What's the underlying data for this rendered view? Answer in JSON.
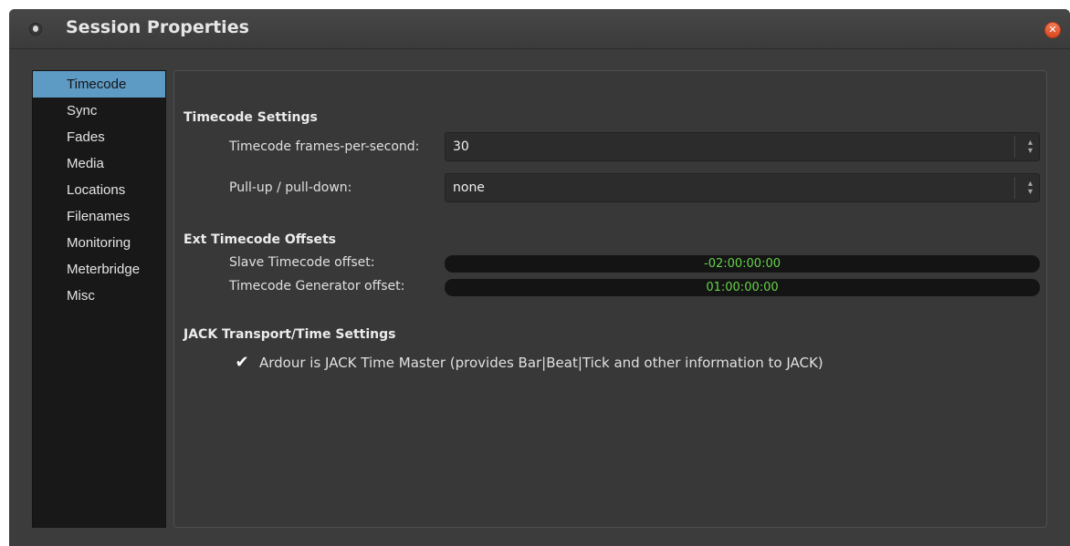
{
  "window": {
    "title": "Session Properties"
  },
  "sidebar": {
    "items": [
      {
        "label": "Timecode",
        "active": true
      },
      {
        "label": "Sync"
      },
      {
        "label": "Fades"
      },
      {
        "label": "Media"
      },
      {
        "label": "Locations"
      },
      {
        "label": "Filenames"
      },
      {
        "label": "Monitoring"
      },
      {
        "label": "Meterbridge"
      },
      {
        "label": "Misc"
      }
    ]
  },
  "timecode_settings": {
    "heading": "Timecode Settings",
    "fps_label": "Timecode frames-per-second:",
    "fps_value": "30",
    "pull_label": "Pull-up / pull-down:",
    "pull_value": "none"
  },
  "ext_offsets": {
    "heading": "Ext Timecode Offsets",
    "slave_label": "Slave Timecode offset:",
    "slave_value": "-02:00:00:00",
    "generator_label": "Timecode Generator offset:",
    "generator_value": "01:00:00:00"
  },
  "jack": {
    "heading": "JACK Transport/Time Settings",
    "master_checked": true,
    "master_label": "Ardour is JACK Time Master (provides Bar|Beat|Tick and other information to JACK)"
  },
  "icons": {
    "app": "app-icon",
    "close": "close-icon",
    "combo_arrows": "up-down-arrows-icon",
    "checkmark": "checkmark-icon"
  },
  "colors": {
    "accent": "#5e9bc4",
    "clock_text": "#66d34a",
    "close": "#e55b33"
  }
}
